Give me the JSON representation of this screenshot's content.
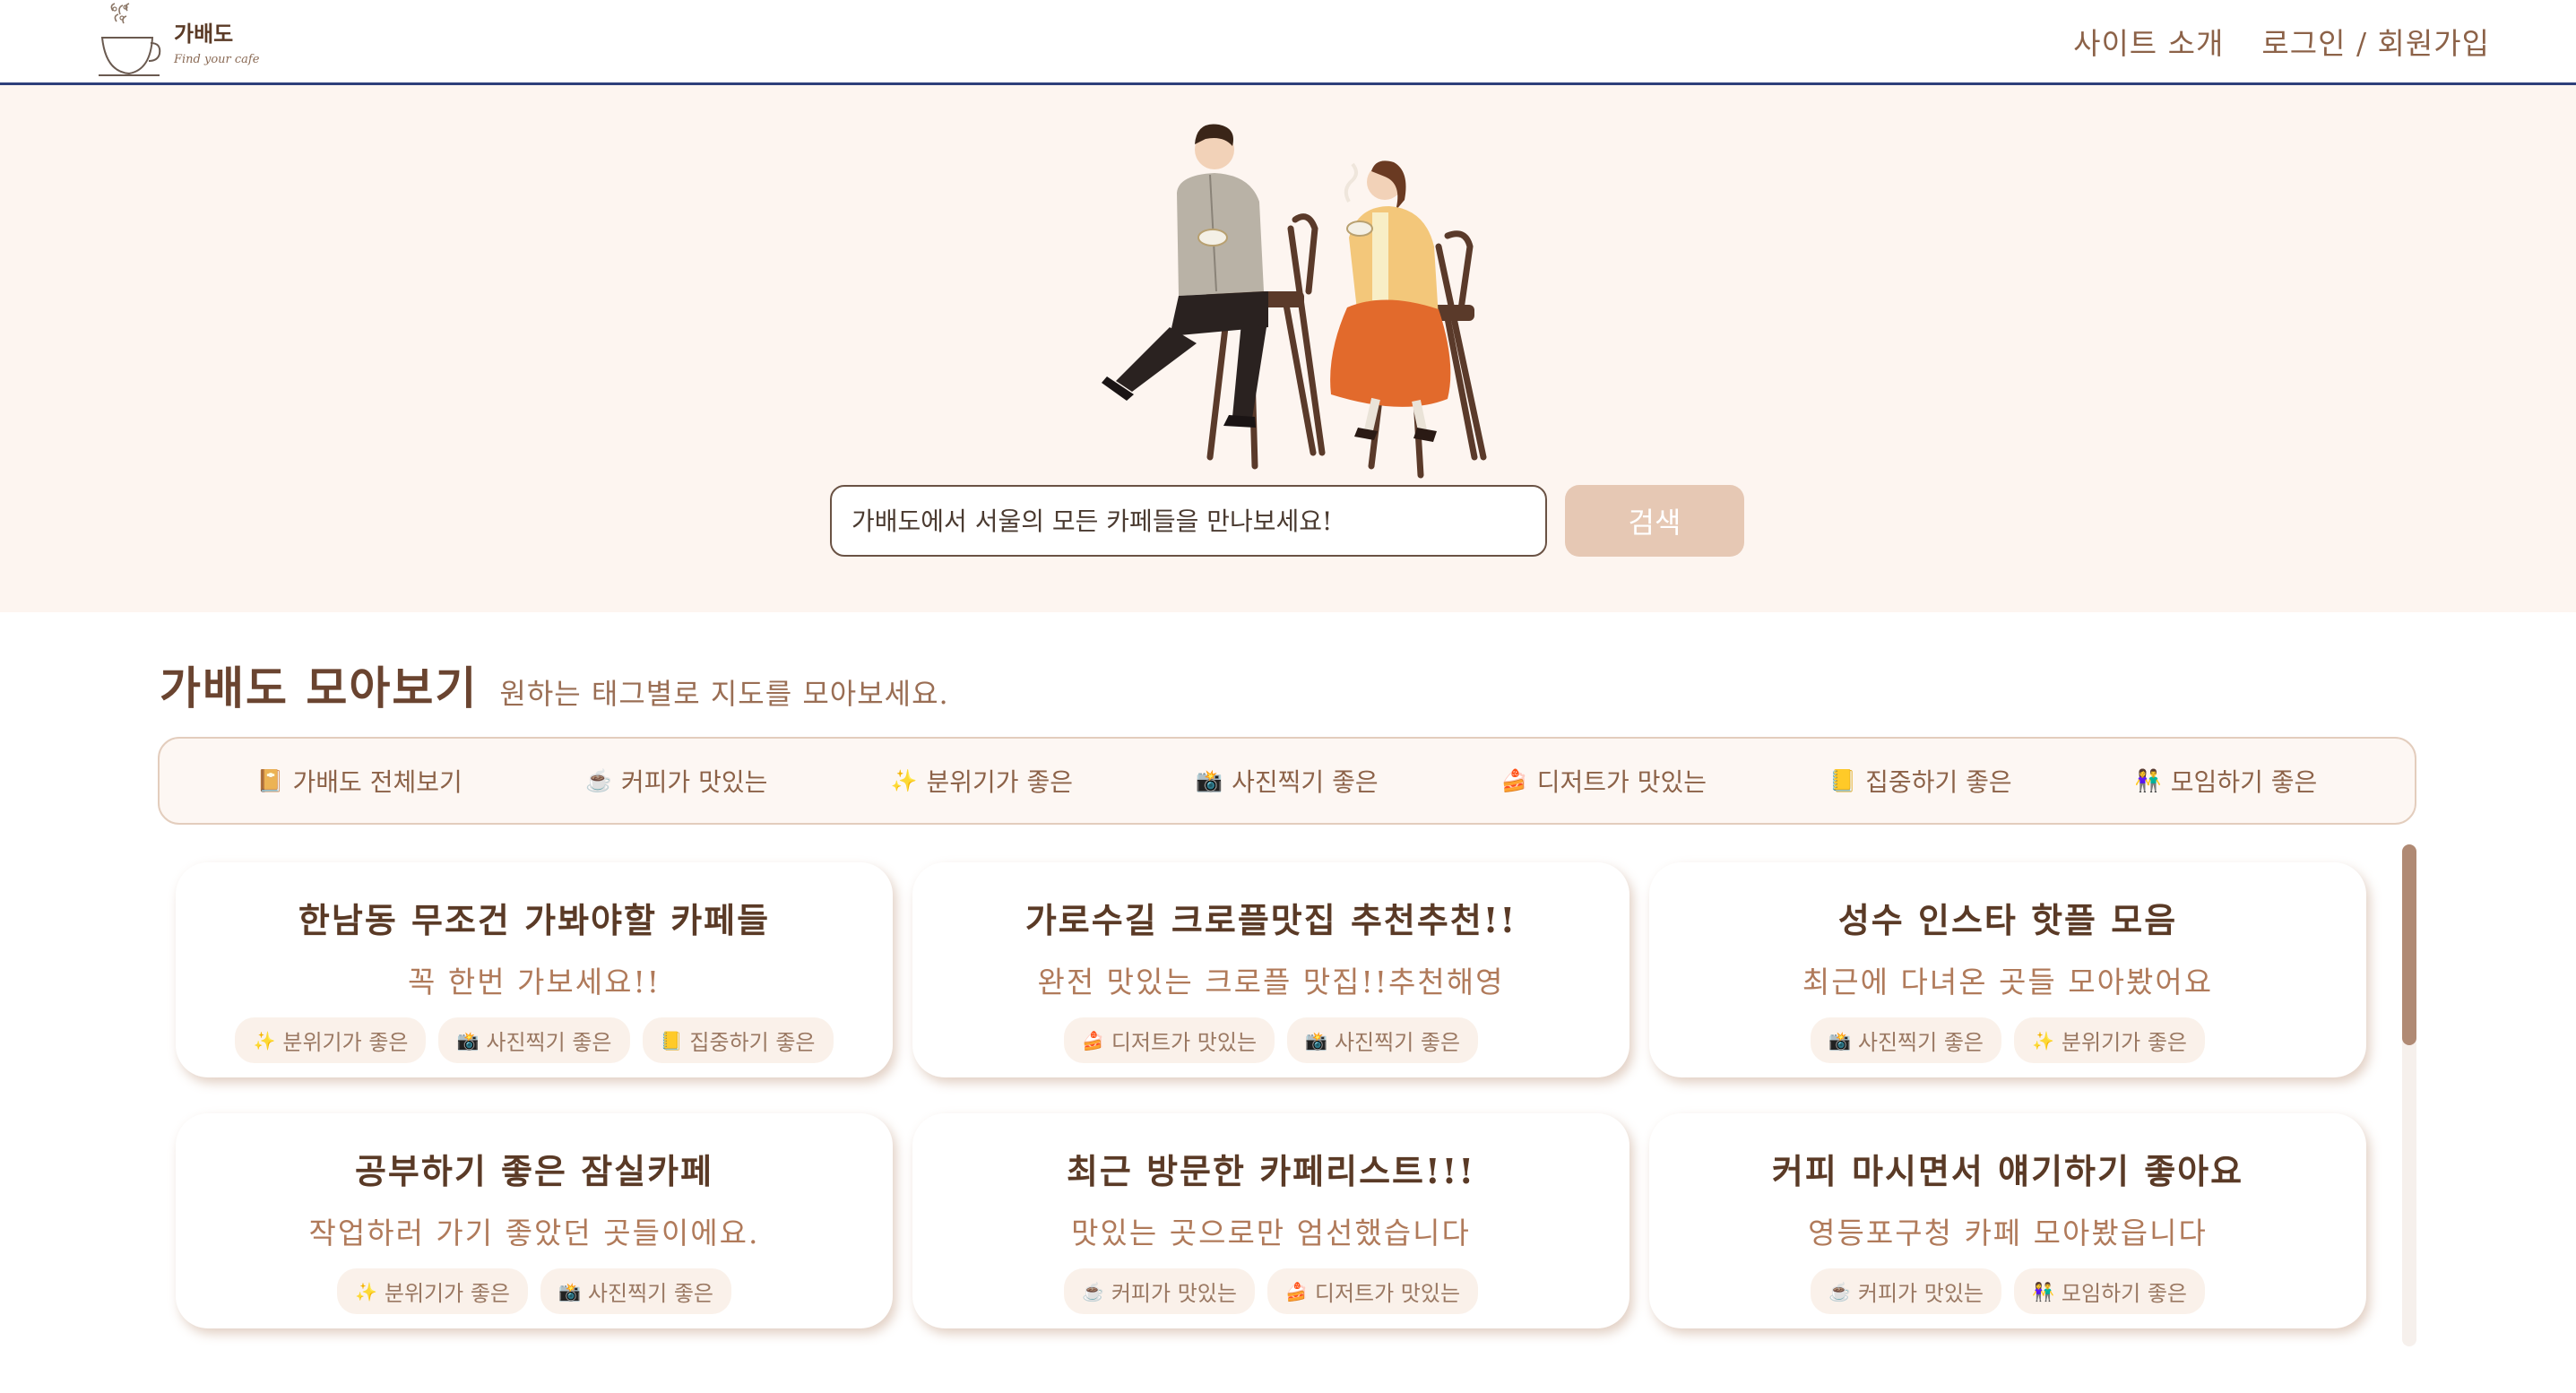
{
  "header": {
    "logo_name": "가배도",
    "logo_sub": "Find your cafe",
    "nav": {
      "about": "사이트 소개",
      "login": "로그인 / 회원가입"
    }
  },
  "hero": {
    "search_placeholder": "가배도에서 서울의 모든 카페들을 만나보세요!",
    "search_button": "검색"
  },
  "section": {
    "title": "가배도 모아보기",
    "subtitle": "원하는 태그별로 지도를 모아보세요."
  },
  "tags": [
    {
      "emoji": "📔",
      "label": "가배도 전체보기"
    },
    {
      "emoji": "☕",
      "label": "커피가 맛있는"
    },
    {
      "emoji": "✨",
      "label": "분위기가 좋은"
    },
    {
      "emoji": "📸",
      "label": "사진찍기 좋은"
    },
    {
      "emoji": "🍰",
      "label": "디저트가 맛있는"
    },
    {
      "emoji": "📒",
      "label": "집중하기 좋은"
    },
    {
      "emoji": "👫",
      "label": "모임하기 좋은"
    }
  ],
  "cards": [
    {
      "title": "한남동 무조건 가봐야할 카페들",
      "desc": "꼭 한번 가보세요!!",
      "tags": [
        {
          "emoji": "✨",
          "label": "분위기가 좋은"
        },
        {
          "emoji": "📸",
          "label": "사진찍기 좋은"
        },
        {
          "emoji": "📒",
          "label": "집중하기 좋은"
        }
      ]
    },
    {
      "title": "가로수길 크로플맛집 추천추천!!",
      "desc": "완전 맛있는 크로플 맛집!!추천해영",
      "tags": [
        {
          "emoji": "🍰",
          "label": "디저트가 맛있는"
        },
        {
          "emoji": "📸",
          "label": "사진찍기 좋은"
        }
      ]
    },
    {
      "title": "성수 인스타 핫플 모음",
      "desc": "최근에 다녀온 곳들 모아봤어요",
      "tags": [
        {
          "emoji": "📸",
          "label": "사진찍기 좋은"
        },
        {
          "emoji": "✨",
          "label": "분위기가 좋은"
        }
      ]
    },
    {
      "title": "공부하기 좋은 잠실카페",
      "desc": "작업하러 가기 좋았던 곳들이에요.",
      "tags": [
        {
          "emoji": "✨",
          "label": "분위기가 좋은"
        },
        {
          "emoji": "📸",
          "label": "사진찍기 좋은"
        }
      ]
    },
    {
      "title": "최근 방문한 카페리스트!!!",
      "desc": "맛있는 곳으로만 엄선했습니다",
      "tags": [
        {
          "emoji": "☕",
          "label": "커피가 맛있는"
        },
        {
          "emoji": "🍰",
          "label": "디저트가 맛있는"
        }
      ]
    },
    {
      "title": "커피 마시면서 얘기하기 좋아요",
      "desc": "영등포구청 카페 모아봤읍니다",
      "tags": [
        {
          "emoji": "☕",
          "label": "커피가 맛있는"
        },
        {
          "emoji": "👫",
          "label": "모임하기 좋은"
        }
      ]
    }
  ],
  "colors": {
    "accent": "#7a5138",
    "hero_bg": "#fdf5f0",
    "button": "#e6c8b4",
    "header_border": "#2e3f7a"
  }
}
